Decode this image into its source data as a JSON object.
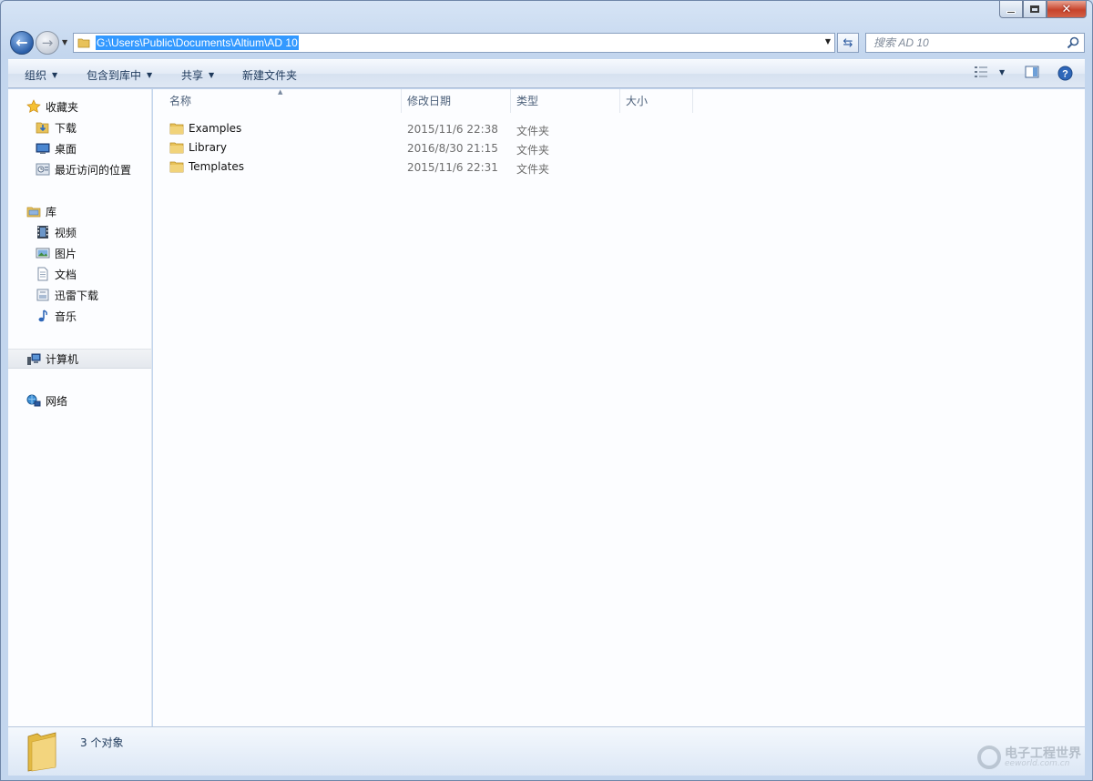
{
  "window": {
    "controls": [
      "minimize",
      "maximize",
      "close"
    ]
  },
  "navigation": {
    "address_path": "G:\\Users\\Public\\Documents\\Altium\\AD 10",
    "search_placeholder": "搜索 AD 10"
  },
  "toolbar": {
    "organize": "组织",
    "include_library": "包含到库中",
    "share": "共享",
    "new_folder": "新建文件夹"
  },
  "sidebar": {
    "favorites": {
      "label": "收藏夹",
      "items": [
        {
          "label": "下载",
          "icon": "download-folder-icon"
        },
        {
          "label": "桌面",
          "icon": "desktop-icon"
        },
        {
          "label": "最近访问的位置",
          "icon": "recent-places-icon"
        }
      ]
    },
    "libraries": {
      "label": "库",
      "items": [
        {
          "label": "视频",
          "icon": "video-icon"
        },
        {
          "label": "图片",
          "icon": "pictures-icon"
        },
        {
          "label": "文档",
          "icon": "documents-icon"
        },
        {
          "label": "迅雷下载",
          "icon": "thunder-download-icon"
        },
        {
          "label": "音乐",
          "icon": "music-icon"
        }
      ]
    },
    "computer": {
      "label": "计算机"
    },
    "network": {
      "label": "网络"
    }
  },
  "columns": {
    "name": "名称",
    "date": "修改日期",
    "type": "类型",
    "size": "大小"
  },
  "files": [
    {
      "name": "Examples",
      "date": "2015/11/6 22:38",
      "type": "文件夹",
      "size": ""
    },
    {
      "name": "Library",
      "date": "2016/8/30 21:15",
      "type": "文件夹",
      "size": ""
    },
    {
      "name": "Templates",
      "date": "2015/11/6 22:31",
      "type": "文件夹",
      "size": ""
    }
  ],
  "status": {
    "item_count": "3 个对象"
  },
  "watermark": {
    "title": "电子工程世界",
    "subtitle": "eeworld.com.cn"
  },
  "colors": {
    "selection": "#3399ff",
    "folder": "#e8c25a",
    "header_text": "#4c607a"
  }
}
